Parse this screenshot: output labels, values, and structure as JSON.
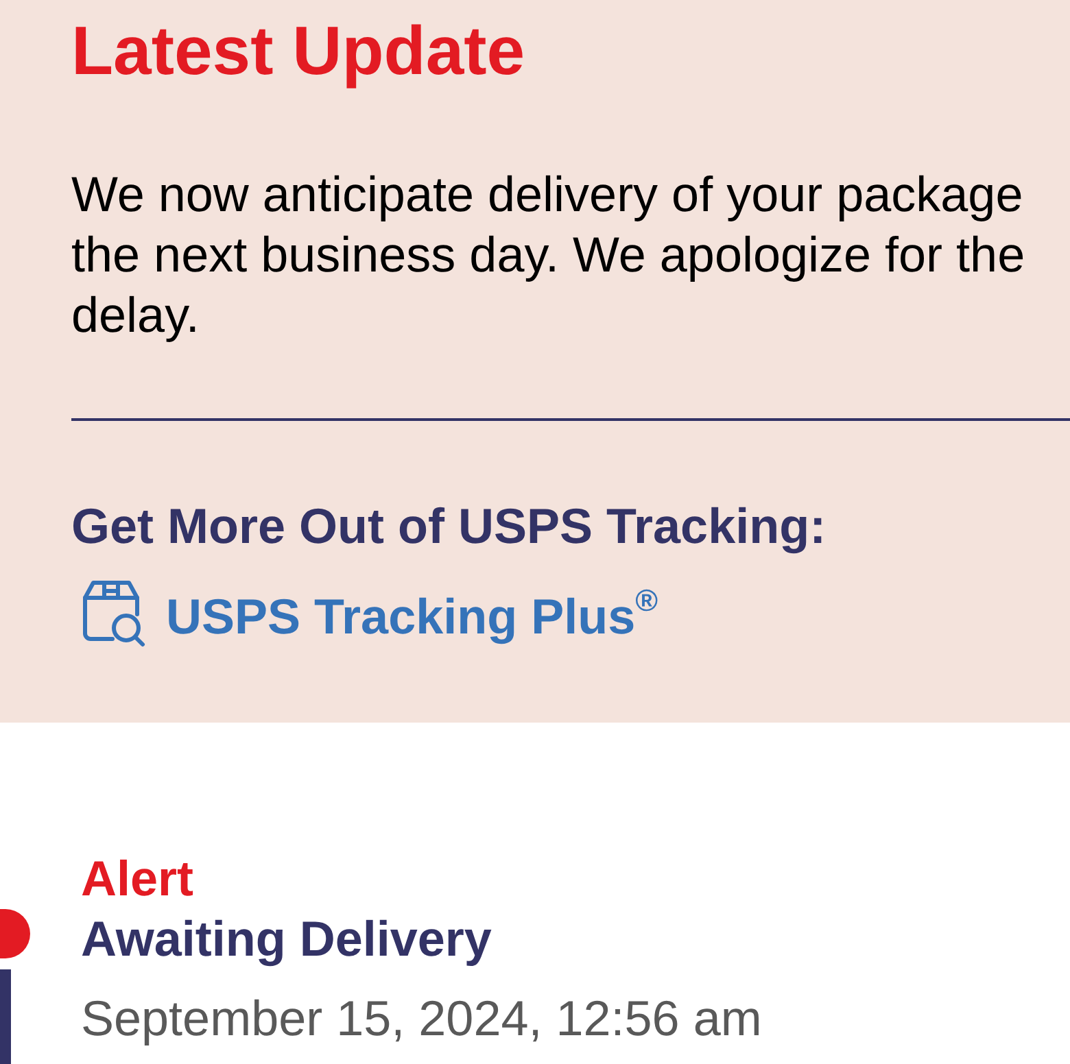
{
  "latest_update": {
    "title": "Latest Update",
    "message": "We now anticipate delivery of your package the next business day. We apologize for the delay."
  },
  "promo": {
    "heading": "Get More Out of USPS Tracking:",
    "link": "USPS Tracking Plus$^{®}$"
  },
  "events": [
    {
      "kind": "alert",
      "label": "Alert",
      "status": "Awaiting Delivery",
      "date": "September 15, 2024, 12:56 am"
    }
  ]
}
